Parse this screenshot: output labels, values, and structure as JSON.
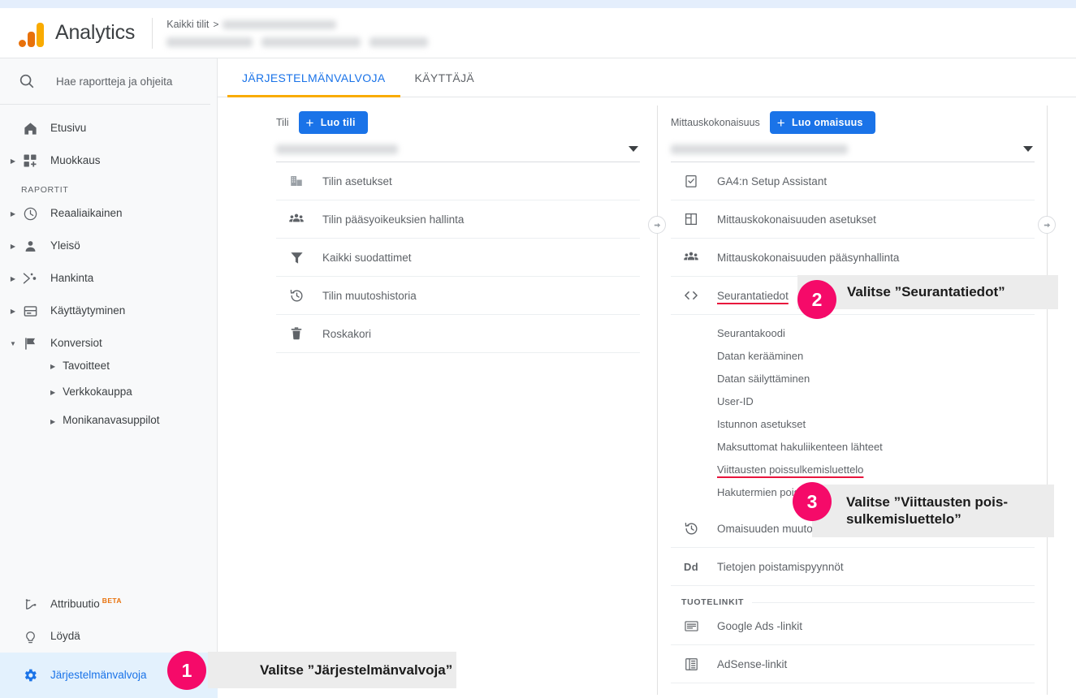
{
  "app": {
    "brand": "Analytics",
    "logo_icon": "google-analytics-logo"
  },
  "breadcrumb": {
    "all_accounts": "Kaikki tilit",
    "separator": ">",
    "account_name_redacted": "",
    "property_name_redacted": ""
  },
  "sidebar": {
    "search": {
      "placeholder": "Hae raportteja ja ohjeita",
      "icon": "search-icon"
    },
    "top_items": [
      {
        "label": "Etusivu",
        "icon": "home-icon",
        "expandable": false
      },
      {
        "label": "Muokkaus",
        "icon": "customization-icon",
        "expandable": true
      }
    ],
    "section_label": "RAPORTIT",
    "report_items": [
      {
        "label": "Reaaliaikainen",
        "icon": "clock-icon",
        "expandable": true
      },
      {
        "label": "Yleisö",
        "icon": "person-icon",
        "expandable": true
      },
      {
        "label": "Hankinta",
        "icon": "acquisition-icon",
        "expandable": true
      },
      {
        "label": "Käyttäytyminen",
        "icon": "behavior-icon",
        "expandable": true
      },
      {
        "label": "Konversiot",
        "icon": "flag-icon",
        "expandable": true,
        "expanded": true
      }
    ],
    "conversion_subitems": [
      {
        "label": "Tavoitteet"
      },
      {
        "label": "Verkkokauppa"
      },
      {
        "label": "Monikanavasuppilot"
      }
    ],
    "bottom_items": [
      {
        "label": "Attribuutio",
        "icon": "attribution-icon",
        "badge": "BETA",
        "active": false
      },
      {
        "label": "Löydä",
        "icon": "bulb-icon",
        "active": false
      },
      {
        "label": "Järjestelmänvalvoja",
        "icon": "gear-icon",
        "active": true
      }
    ]
  },
  "tabs": [
    {
      "label": "JÄRJESTELMÄNVALVOJA",
      "active": true
    },
    {
      "label": "KÄYTTÄJÄ",
      "active": false
    }
  ],
  "account_column": {
    "label": "Tili",
    "create_button": "Luo tili",
    "selector_value_redacted": "",
    "items": [
      {
        "label": "Tilin asetukset",
        "icon": "building-icon"
      },
      {
        "label": "Tilin pääsyoikeuksien hallinta",
        "icon": "people-icon"
      },
      {
        "label": "Kaikki suodattimet",
        "icon": "filter-icon"
      },
      {
        "label": "Tilin muutoshistoria",
        "icon": "history-icon"
      },
      {
        "label": "Roskakori",
        "icon": "trash-icon"
      }
    ]
  },
  "property_column": {
    "label": "Mittauskokonaisuus",
    "create_button": "Luo omaisuus",
    "selector_value_redacted": "",
    "items": [
      {
        "label": "GA4:n Setup Assistant",
        "icon": "checklist-icon"
      },
      {
        "label": "Mittauskokonaisuuden asetukset",
        "icon": "layout-icon"
      },
      {
        "label": "Mittauskokonaisuuden pääsynhallinta",
        "icon": "people-icon"
      },
      {
        "label": "Seurantatiedot",
        "icon": "code-icon",
        "highlighted": true
      }
    ],
    "tracking_subitems": [
      {
        "label": "Seurantakoodi"
      },
      {
        "label": "Datan kerääminen"
      },
      {
        "label": "Datan säilyttäminen"
      },
      {
        "label": "User-ID"
      },
      {
        "label": "Istunnon asetukset"
      },
      {
        "label": "Maksuttomat hakuliikenteen lähteet"
      },
      {
        "label": "Viittausten poissulkemisluettelo",
        "highlighted": true
      },
      {
        "label": "Hakutermien poissulkemisluettelo"
      }
    ],
    "lower_items": [
      {
        "label": "Omaisuuden muutoshistoria",
        "icon": "history-icon"
      },
      {
        "label": "Tietojen poistamispyynnöt",
        "icon": "dd-icon"
      }
    ],
    "product_links_label": "TUOTELINKIT",
    "product_links": [
      {
        "label": "Google Ads -linkit",
        "icon": "google-ads-icon"
      },
      {
        "label": "AdSense-linkit",
        "icon": "adsense-icon"
      }
    ]
  },
  "callouts": [
    {
      "number": "1",
      "text": "Valitse ”Järjestelmänvalvoja”"
    },
    {
      "number": "2",
      "text": "Valitse ”Seurantatiedot”"
    },
    {
      "number": "3",
      "text": "Valitse ”Viittausten pois-\nsulkemisluettelo”"
    }
  ],
  "colors": {
    "badge_pink": "#f50a69",
    "accent_blue": "#1a73e8",
    "tab_underline_orange": "#f9ab00",
    "underline_red": "#e8143c",
    "beta_orange": "#e8710a"
  },
  "arrow_buttons": {
    "icon": "arrow-right-circle-icon",
    "count": 2
  }
}
